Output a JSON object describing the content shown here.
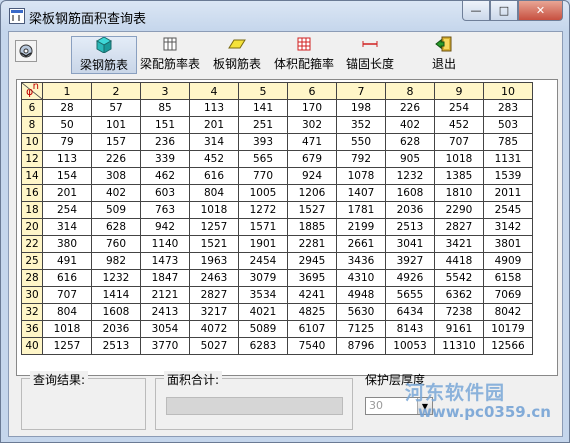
{
  "window": {
    "title": "梁板钢筋面积查询表",
    "minimize_glyph": "—",
    "maximize_glyph": "□",
    "close_glyph": "✕"
  },
  "toolbar": {
    "buttons": [
      {
        "label": "梁钢筋表",
        "icon": "beam-rebar-icon",
        "active": true
      },
      {
        "label": "梁配筋率表",
        "icon": "beam-ratio-icon",
        "active": false
      },
      {
        "label": "板钢筋表",
        "icon": "slab-rebar-icon",
        "active": false
      },
      {
        "label": "体积配箍率",
        "icon": "stirrup-ratio-icon",
        "active": false
      },
      {
        "label": "锚固长度",
        "icon": "anchorage-icon",
        "active": false
      },
      {
        "label": "退出",
        "icon": "exit-icon",
        "active": false
      }
    ]
  },
  "table": {
    "corner": {
      "phi": "φ",
      "n": "n"
    },
    "columns": [
      "1",
      "2",
      "3",
      "4",
      "5",
      "6",
      "7",
      "8",
      "9",
      "10"
    ],
    "rows": [
      {
        "d": "6",
        "v": [
          "28",
          "57",
          "85",
          "113",
          "141",
          "170",
          "198",
          "226",
          "254",
          "283"
        ]
      },
      {
        "d": "8",
        "v": [
          "50",
          "101",
          "151",
          "201",
          "251",
          "302",
          "352",
          "402",
          "452",
          "503"
        ]
      },
      {
        "d": "10",
        "v": [
          "79",
          "157",
          "236",
          "314",
          "393",
          "471",
          "550",
          "628",
          "707",
          "785"
        ]
      },
      {
        "d": "12",
        "v": [
          "113",
          "226",
          "339",
          "452",
          "565",
          "679",
          "792",
          "905",
          "1018",
          "1131"
        ]
      },
      {
        "d": "14",
        "v": [
          "154",
          "308",
          "462",
          "616",
          "770",
          "924",
          "1078",
          "1232",
          "1385",
          "1539"
        ]
      },
      {
        "d": "16",
        "v": [
          "201",
          "402",
          "603",
          "804",
          "1005",
          "1206",
          "1407",
          "1608",
          "1810",
          "2011"
        ]
      },
      {
        "d": "18",
        "v": [
          "254",
          "509",
          "763",
          "1018",
          "1272",
          "1527",
          "1781",
          "2036",
          "2290",
          "2545"
        ]
      },
      {
        "d": "20",
        "v": [
          "314",
          "628",
          "942",
          "1257",
          "1571",
          "1885",
          "2199",
          "2513",
          "2827",
          "3142"
        ]
      },
      {
        "d": "22",
        "v": [
          "380",
          "760",
          "1140",
          "1521",
          "1901",
          "2281",
          "2661",
          "3041",
          "3421",
          "3801"
        ]
      },
      {
        "d": "25",
        "v": [
          "491",
          "982",
          "1473",
          "1963",
          "2454",
          "2945",
          "3436",
          "3927",
          "4418",
          "4909"
        ]
      },
      {
        "d": "28",
        "v": [
          "616",
          "1232",
          "1847",
          "2463",
          "3079",
          "3695",
          "4310",
          "4926",
          "5542",
          "6158"
        ]
      },
      {
        "d": "30",
        "v": [
          "707",
          "1414",
          "2121",
          "2827",
          "3534",
          "4241",
          "4948",
          "5655",
          "6362",
          "7069"
        ]
      },
      {
        "d": "32",
        "v": [
          "804",
          "1608",
          "2413",
          "3217",
          "4021",
          "4825",
          "5630",
          "6434",
          "7238",
          "8042"
        ]
      },
      {
        "d": "36",
        "v": [
          "1018",
          "2036",
          "3054",
          "4072",
          "5089",
          "6107",
          "7125",
          "8143",
          "9161",
          "10179"
        ]
      },
      {
        "d": "40",
        "v": [
          "1257",
          "2513",
          "3770",
          "5027",
          "6283",
          "7540",
          "8796",
          "10053",
          "11310",
          "12566"
        ]
      }
    ]
  },
  "bottom": {
    "query_result_label": "查询结果:",
    "area_sum_label": "面积合计:",
    "cover_label": "保护层厚度",
    "cover_value": "30",
    "dropdown_glyph": "▼"
  },
  "watermark": {
    "text": "河东软件园",
    "url": "www.pc0359.cn"
  }
}
